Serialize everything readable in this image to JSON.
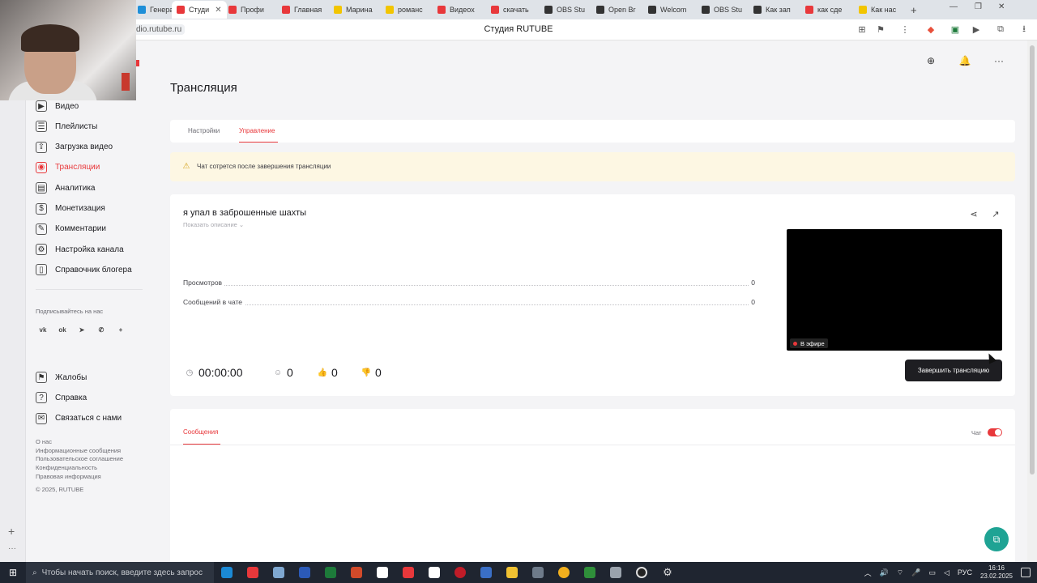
{
  "browser": {
    "tabs": [
      {
        "label": "Генера",
        "color": "#1f8fd8"
      },
      {
        "label": "Студи",
        "color": "#e8383b",
        "active": true
      },
      {
        "label": "Профи",
        "color": "#e8383b"
      },
      {
        "label": "Главная",
        "color": "#e8383b"
      },
      {
        "label": "Марина",
        "color": "#f2c500"
      },
      {
        "label": "романс",
        "color": "#f2c500"
      },
      {
        "label": "Видеох",
        "color": "#e8383b"
      },
      {
        "label": "скачать",
        "color": "#e8383b"
      },
      {
        "label": "OBS Stu",
        "color": "#333333"
      },
      {
        "label": "Open Br",
        "color": "#333333"
      },
      {
        "label": "Welcom",
        "color": "#333333"
      },
      {
        "label": "OBS Stu",
        "color": "#333333"
      },
      {
        "label": "Как зап",
        "color": "#333333"
      },
      {
        "label": "как сде",
        "color": "#e8383b"
      },
      {
        "label": "Как нас",
        "color": "#f2c500"
      }
    ],
    "url": "dio.rutube.ru",
    "title": "Студия RUTUBE"
  },
  "sidebar": {
    "items": [
      {
        "label": "Видео",
        "icon": "video-icon"
      },
      {
        "label": "Плейлисты",
        "icon": "list-icon"
      },
      {
        "label": "Загрузка видео",
        "icon": "upload-icon"
      },
      {
        "label": "Трансляции",
        "icon": "broadcast-icon",
        "active": true
      },
      {
        "label": "Аналитика",
        "icon": "analytics-icon"
      },
      {
        "label": "Монетизация",
        "icon": "coin-icon"
      },
      {
        "label": "Комментарии",
        "icon": "comment-icon"
      },
      {
        "label": "Настройка канала",
        "icon": "settings-icon"
      },
      {
        "label": "Справочник блогера",
        "icon": "book-icon"
      }
    ],
    "subscribe_label": "Подписывайтесь на нас",
    "socials": [
      "vk",
      "ok",
      "tg",
      "viber",
      "+"
    ],
    "bottom_items": [
      {
        "label": "Жалобы",
        "icon": "flag-icon"
      },
      {
        "label": "Справка",
        "icon": "help-icon"
      },
      {
        "label": "Связаться с нами",
        "icon": "mail-icon"
      }
    ],
    "footer_links": [
      "О нас",
      "Информационные сообщения",
      "Пользовательское соглашение",
      "Конфиденциальность",
      "Правовая информация",
      "© 2025, RUTUBE"
    ]
  },
  "main": {
    "title": "Трансляция",
    "tabs": [
      {
        "label": "Настройки"
      },
      {
        "label": "Управление",
        "active": true
      }
    ],
    "banner_text": "Чат сотрется после завершения трансляции",
    "stream": {
      "title": "я упал в заброшенные шахты",
      "show_description": "Показать описание",
      "stats": [
        {
          "label": "Просмотров",
          "value": "0"
        },
        {
          "label": "Сообщений в чате",
          "value": "0"
        }
      ],
      "live_label": "В эфире",
      "duration": "00:00:00",
      "viewers": "0",
      "likes": "0",
      "dislikes": "0",
      "end_button": "Завершить трансляцию"
    },
    "messages": {
      "tab": "Сообщения",
      "chat_label": "Чат",
      "chat_enabled": true
    }
  },
  "taskbar": {
    "search_placeholder": "Чтобы начать поиск, введите здесь запрос",
    "lang": "РУС",
    "time": "16:16",
    "date": "23.02.2025"
  },
  "colors": {
    "accent": "#e8383b",
    "support": "#1fa394"
  }
}
